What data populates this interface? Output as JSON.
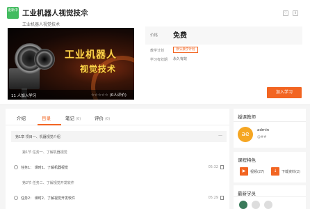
{
  "header": {
    "badge": "更新中",
    "title": "工业机器人视觉技术",
    "subtitle": "工业机器人视觉技术"
  },
  "cover": {
    "line1": "工业机器人",
    "line2": "视觉技术",
    "learners": "11 人加入学习",
    "stars": "☆☆☆☆☆",
    "rating": "(0人评价)"
  },
  "info": {
    "price_label": "价格",
    "price_value": "免费",
    "plan_label": "教学计划",
    "plan_value": "默认教学计划",
    "validity_label": "学习有效期",
    "validity_value": "永久有效",
    "join_button": "加入学习"
  },
  "tabs": [
    {
      "label": "介绍",
      "count": ""
    },
    {
      "label": "目录",
      "count": ""
    },
    {
      "label": "笔记",
      "count": "(0)"
    },
    {
      "label": "评价",
      "count": "(0)"
    }
  ],
  "catalog": {
    "chapter1": "第1章  项目一、机器视觉介绍",
    "section1": "第1节  任务一、了解机器视觉",
    "task1": "任务1：  课时1、了解机器视觉",
    "task1_time": "05:32",
    "section2": "第2节  任务二、了解视觉开发软件",
    "task2": "任务2：  课时2、了解视觉开发软件",
    "task2_time": "05:29"
  },
  "teacher": {
    "title": "授课教师",
    "avatar": "ae",
    "name": "admin",
    "desc": "@##"
  },
  "features": {
    "title": "课程特色",
    "video": "视频(27)",
    "download": "下载资料(2)"
  },
  "students": {
    "title": "最新学员"
  }
}
